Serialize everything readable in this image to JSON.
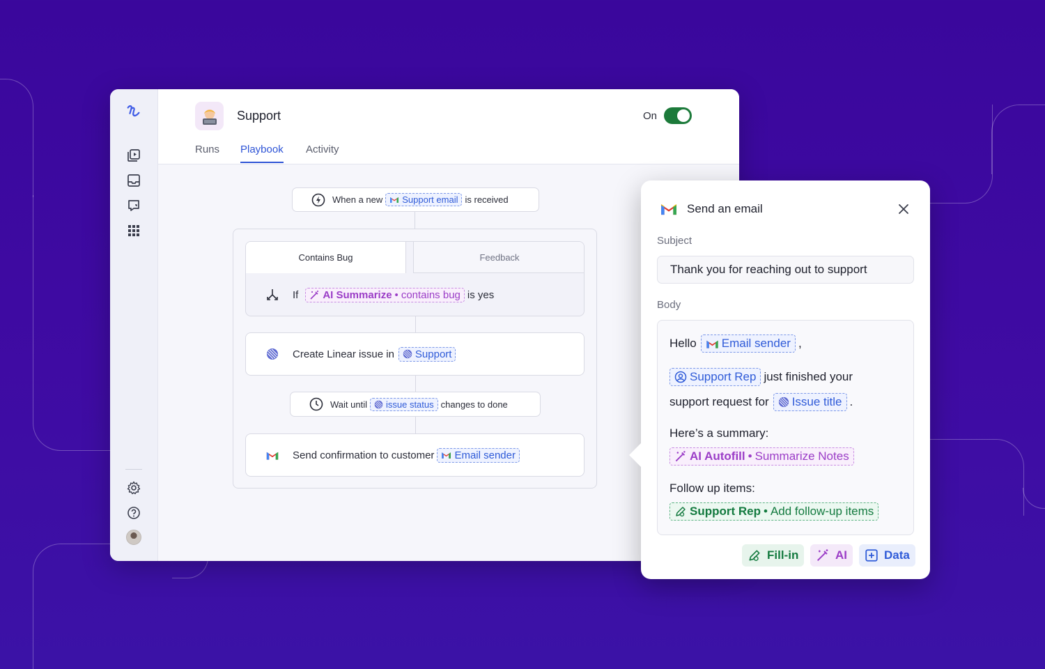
{
  "app": {
    "title": "Support",
    "status_label": "On",
    "tabs": [
      {
        "label": "Runs"
      },
      {
        "label": "Playbook"
      },
      {
        "label": "Activity"
      }
    ]
  },
  "trigger": {
    "prefix": "When a new",
    "chip": "Support email",
    "suffix": "is received"
  },
  "branch": {
    "tabs": [
      {
        "label": "Contains Bug"
      },
      {
        "label": "Feedback"
      }
    ],
    "if_label": "If",
    "chip_main": "AI Summarize",
    "chip_sep": "•",
    "chip_sub": "contains bug",
    "suffix": "is yes"
  },
  "steps": {
    "linear": {
      "label": "Create Linear issue in",
      "chip": "Support"
    },
    "wait": {
      "prefix": "Wait until",
      "chip": "issue status",
      "suffix": "changes to done"
    },
    "confirm": {
      "label": "Send confirmation to customer",
      "chip": "Email sender"
    }
  },
  "panel": {
    "title": "Send an email",
    "subject_label": "Subject",
    "subject_value": "Thank you for reaching out to support",
    "body_label": "Body",
    "body": {
      "hello": "Hello",
      "sender_chip": "Email sender",
      "comma": ",",
      "rep_chip": "Support Rep",
      "finished": "just finished your",
      "request_for": "support request for",
      "issue_chip": "Issue title",
      "period": ".",
      "summary_label": "Here’s a summary:",
      "autofill_main": "AI Autofill",
      "autofill_sep": "•",
      "autofill_sub": "Summarize Notes",
      "followup_label": "Follow up items:",
      "rep_fill_main": "Support Rep",
      "rep_fill_sep": "•",
      "rep_fill_sub": "Add follow-up items"
    },
    "actions": {
      "fill": "Fill-in",
      "ai": "AI",
      "data": "Data"
    }
  },
  "colors": {
    "background": "#3a079c",
    "accent_blue": "#2e54d6",
    "toggle_on": "#1c7a3a",
    "ai_purple": "#9b3dc7",
    "fill_green": "#137a3f"
  }
}
